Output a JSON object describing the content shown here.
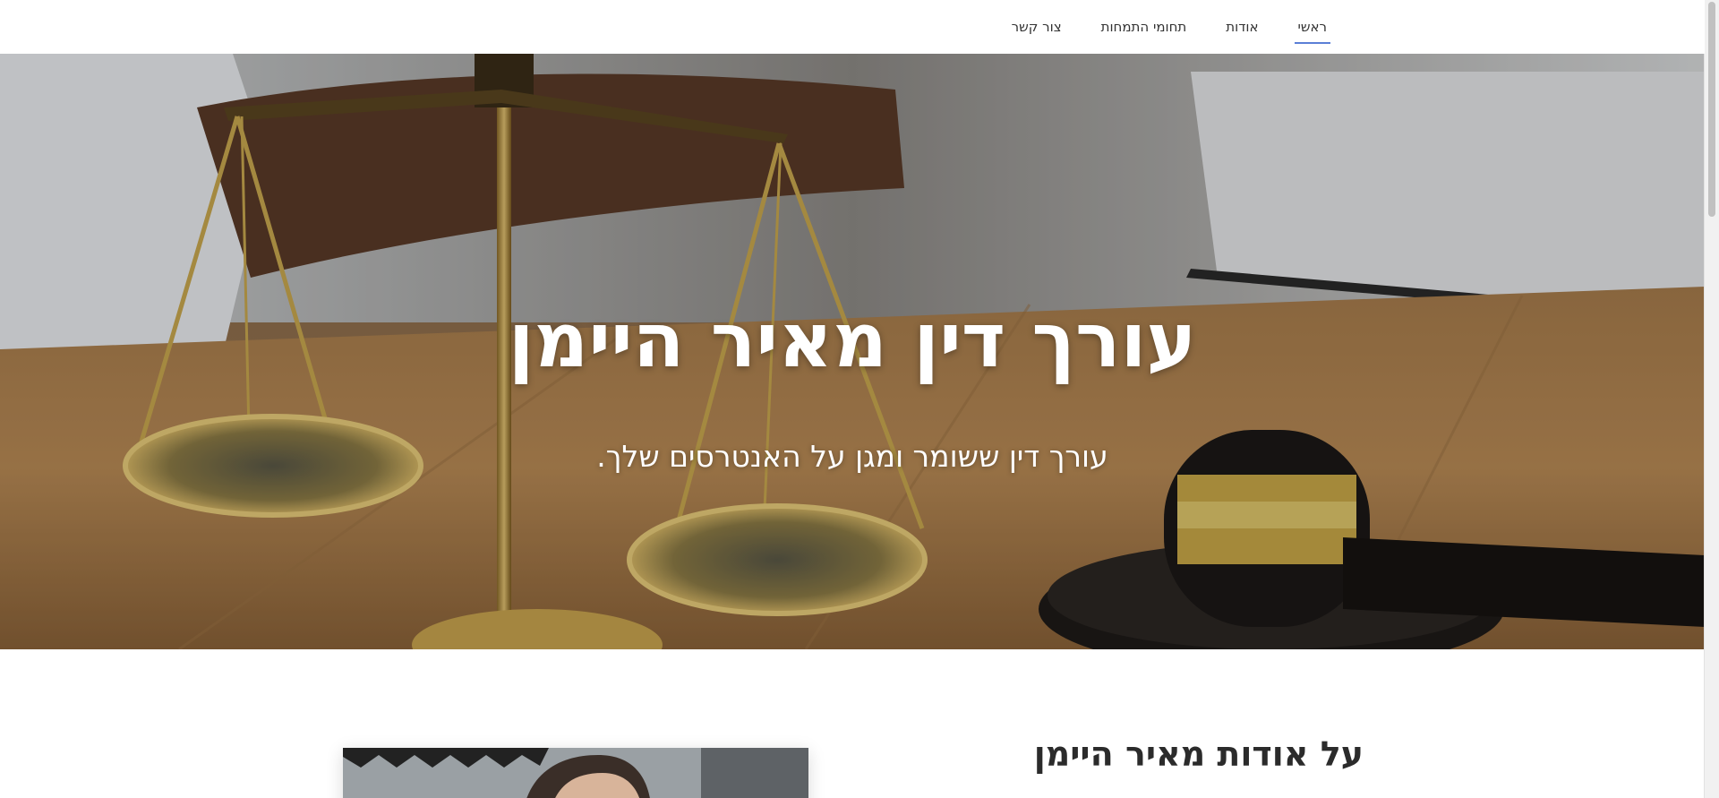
{
  "nav": {
    "items": [
      {
        "label": "ראשי",
        "active": true
      },
      {
        "label": "אודות",
        "active": false
      },
      {
        "label": "תחומי התמחות",
        "active": false
      },
      {
        "label": "צור קשר",
        "active": false
      }
    ],
    "accent_color": "#5b7fd6"
  },
  "hero": {
    "title": "עורך דין מאיר היימן",
    "subtitle": "עורך דין ששומר ומגן על האנטרסים שלך."
  },
  "about": {
    "heading": "על אודות מאיר היימן"
  }
}
